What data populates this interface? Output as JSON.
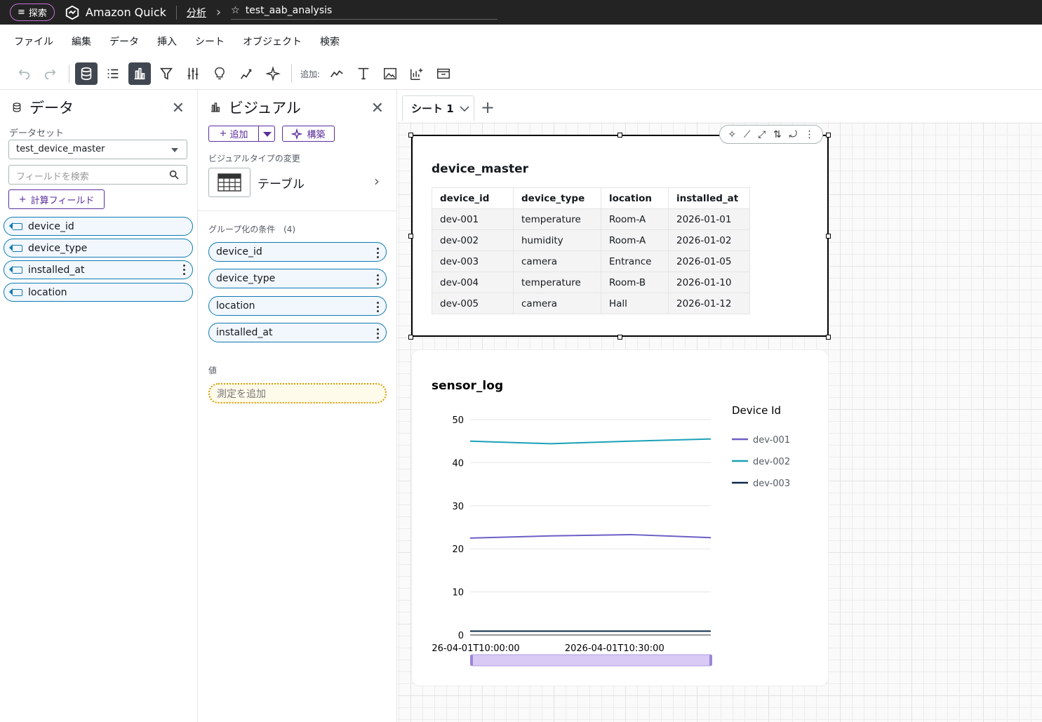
{
  "topbar": {
    "explore_label": "探索",
    "brand": "Amazon Quick",
    "crumb_analysis": "分析",
    "analysis_title": "test_aab_analysis"
  },
  "menu": [
    "ファイル",
    "編集",
    "データ",
    "挿入",
    "シート",
    "オブジェクト",
    "検索"
  ],
  "toolbar": {
    "add_label": "追加:"
  },
  "data_panel": {
    "title": "データ",
    "dataset_label": "データセット",
    "dataset_value": "test_device_master",
    "search_placeholder": "フィールドを検索",
    "calc_field_label": "計算フィールド",
    "fields": [
      "device_id",
      "device_type",
      "installed_at",
      "location"
    ]
  },
  "visual_panel": {
    "title": "ビジュアル",
    "add_label": "追加",
    "build_label": "構築",
    "visual_type_label": "ビジュアルタイプの変更",
    "visual_type_name": "テーブル",
    "group_label": "グループ化の条件",
    "group_count": "(4)",
    "group_fields": [
      "device_id",
      "device_type",
      "location",
      "installed_at"
    ],
    "value_label": "値",
    "measure_placeholder": "測定を追加"
  },
  "sheet": {
    "tab_label": "シート 1"
  },
  "table_visual": {
    "title": "device_master",
    "columns": [
      "device_id",
      "device_type",
      "location",
      "installed_at"
    ],
    "rows": [
      [
        "dev-001",
        "temperature",
        "Room-A",
        "2026-01-01"
      ],
      [
        "dev-002",
        "humidity",
        "Room-A",
        "2026-01-02"
      ],
      [
        "dev-003",
        "camera",
        "Entrance",
        "2026-01-05"
      ],
      [
        "dev-004",
        "temperature",
        "Room-B",
        "2026-01-10"
      ],
      [
        "dev-005",
        "camera",
        "Hall",
        "2026-01-12"
      ]
    ]
  },
  "chart_data": {
    "type": "line",
    "title": "sensor_log",
    "legend_title": "Device Id",
    "legend_position": "right",
    "grid": true,
    "ylim": [
      0,
      50
    ],
    "yticks": [
      0,
      10,
      20,
      30,
      40,
      50
    ],
    "xtick_labels": [
      "26-04-01T10:00:00",
      "2026-04-01T10:30:00"
    ],
    "series": [
      {
        "name": "dev-001",
        "color": "#6b5fc5",
        "values": [
          22.5,
          23.0,
          23.3,
          22.6
        ]
      },
      {
        "name": "dev-002",
        "color": "#1aa1b8",
        "values": [
          45.0,
          44.4,
          45.0,
          45.5
        ]
      },
      {
        "name": "dev-003",
        "color": "#0b2a4a",
        "values": [
          0.9,
          0.9,
          0.9,
          0.9
        ]
      }
    ]
  }
}
